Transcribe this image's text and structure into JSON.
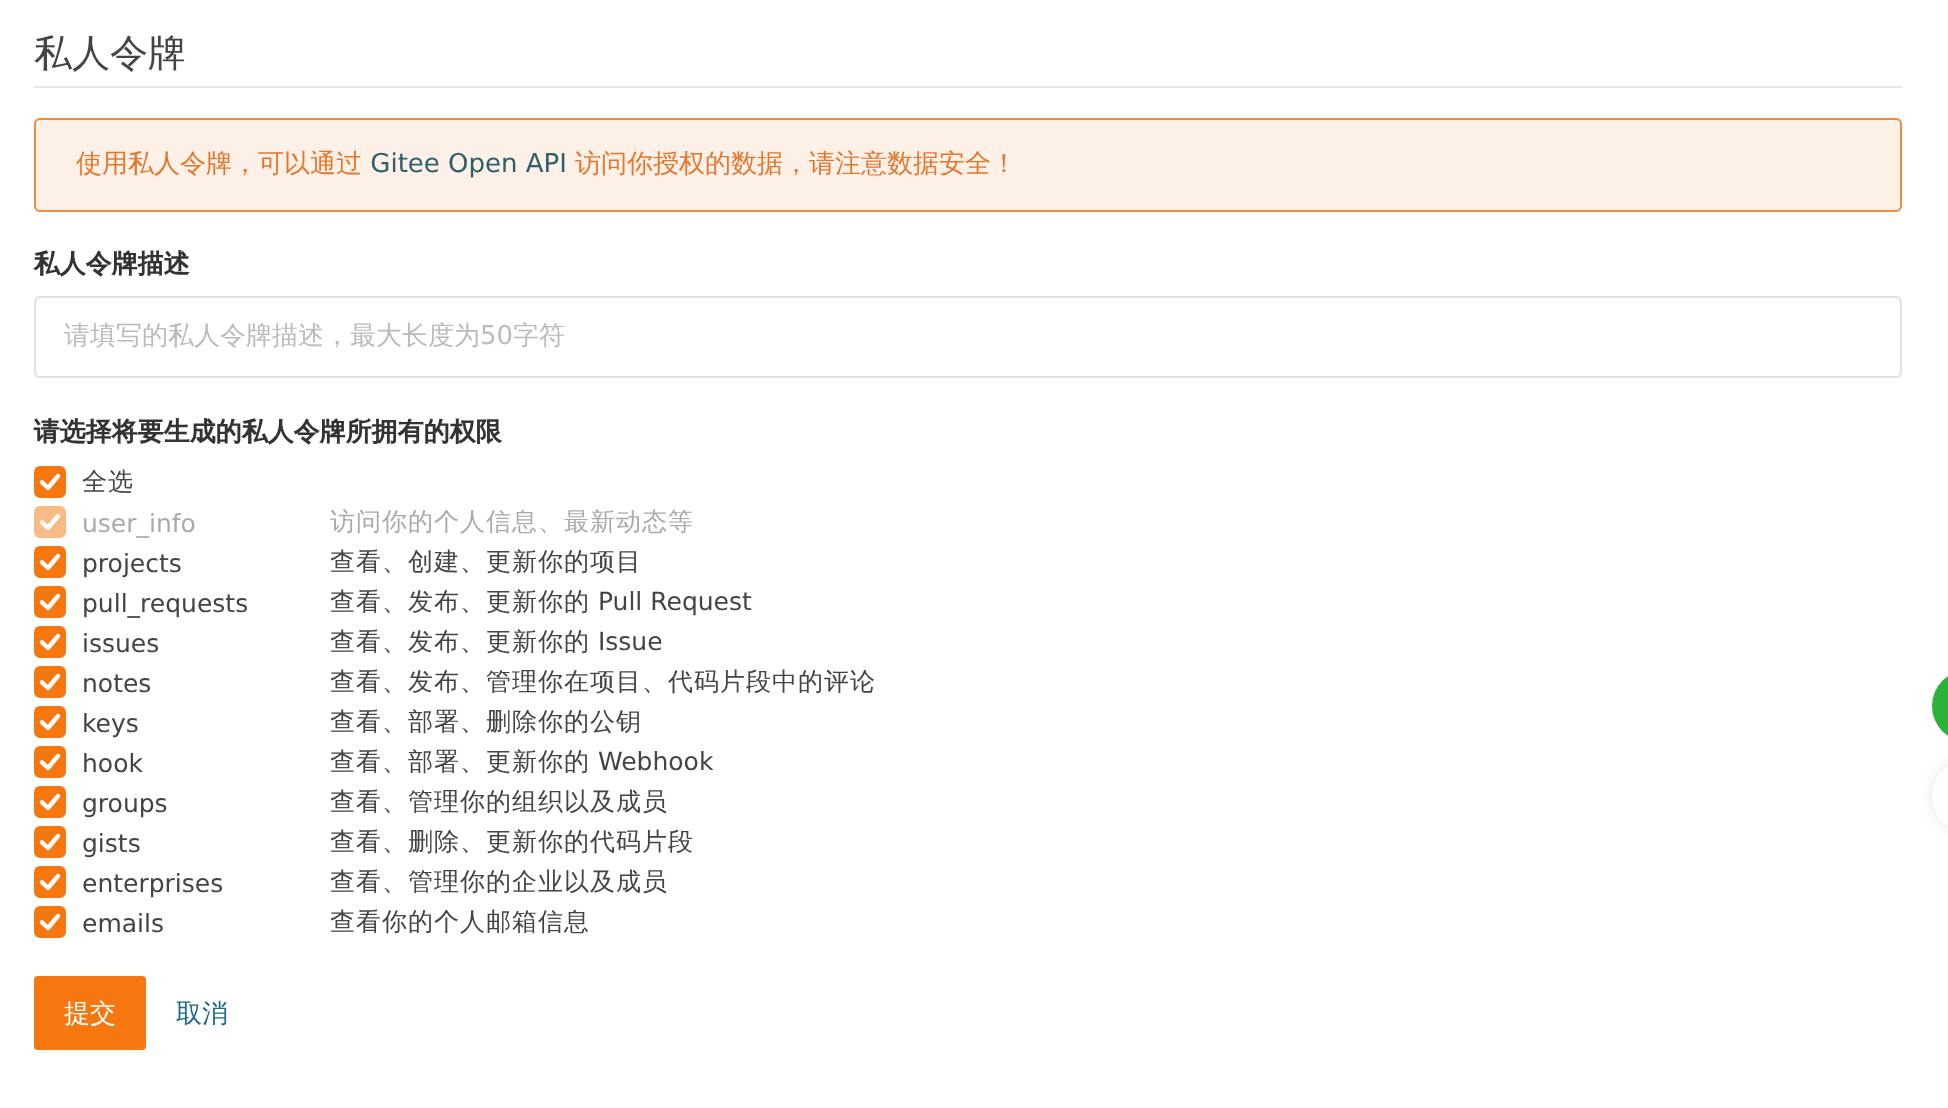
{
  "title": "私人令牌",
  "notice": {
    "parts": [
      {
        "kind": "plain",
        "text": "使用私人令牌，可以通过"
      },
      {
        "kind": "highlight",
        "text": "Gitee Open API"
      },
      {
        "kind": "plain",
        "text": "访问你授权的数据，请注意数据安全！"
      }
    ]
  },
  "description": {
    "label": "私人令牌描述",
    "placeholder": "请填写的私人令牌描述，最大长度为50字符"
  },
  "permissions": {
    "label": "请选择将要生成的私人令牌所拥有的权限",
    "select_all": {
      "label": "全选",
      "checked": true
    },
    "items": [
      {
        "name": "user_info",
        "description": "访问你的个人信息、最新动态等",
        "checked": true,
        "disabled": true
      },
      {
        "name": "projects",
        "description": "查看、创建、更新你的项目",
        "checked": true,
        "disabled": false
      },
      {
        "name": "pull_requests",
        "description": "查看、发布、更新你的 Pull Request",
        "checked": true,
        "disabled": false
      },
      {
        "name": "issues",
        "description": "查看、发布、更新你的 Issue",
        "checked": true,
        "disabled": false
      },
      {
        "name": "notes",
        "description": "查看、发布、管理你在项目、代码片段中的评论",
        "checked": true,
        "disabled": false
      },
      {
        "name": "keys",
        "description": "查看、部署、删除你的公钥",
        "checked": true,
        "disabled": false
      },
      {
        "name": "hook",
        "description": "查看、部署、更新你的 Webhook",
        "checked": true,
        "disabled": false
      },
      {
        "name": "groups",
        "description": "查看、管理你的组织以及成员",
        "checked": true,
        "disabled": false
      },
      {
        "name": "gists",
        "description": "查看、删除、更新你的代码片段",
        "checked": true,
        "disabled": false
      },
      {
        "name": "enterprises",
        "description": "查看、管理你的企业以及成员",
        "checked": true,
        "disabled": false
      },
      {
        "name": "emails",
        "description": "查看你的个人邮箱信息",
        "checked": true,
        "disabled": false
      }
    ]
  },
  "buttons": {
    "submit": "提交",
    "cancel": "取消"
  }
}
